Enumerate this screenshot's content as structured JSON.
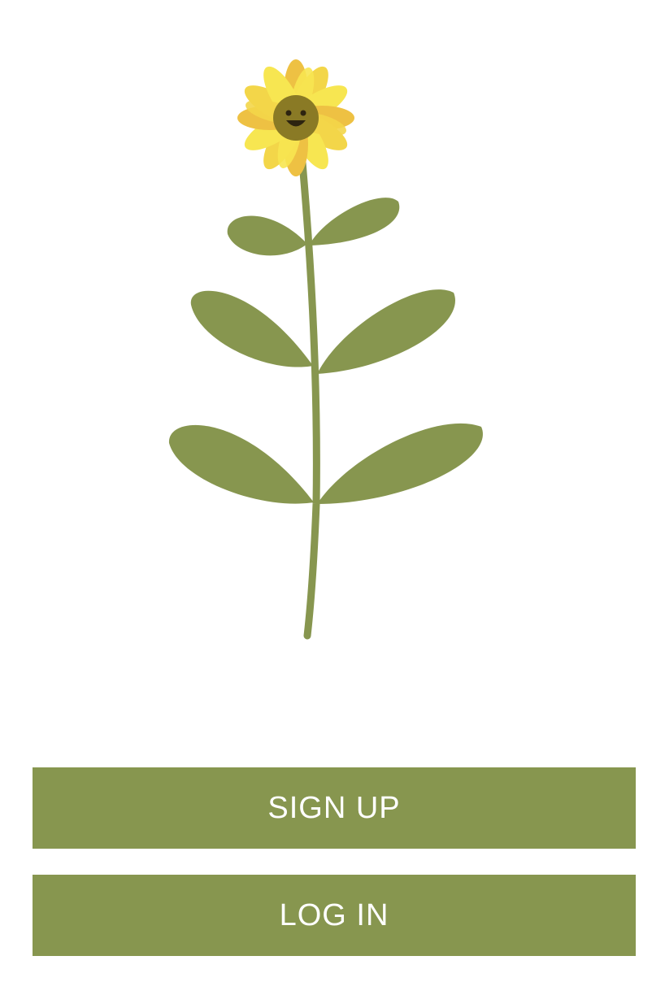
{
  "illustration": {
    "subject": "sunflower-plant",
    "colors": {
      "stem": "#87964f",
      "leaf": "#87964f",
      "petal_light": "#f7e651",
      "petal_mid": "#f3d649",
      "petal_dark": "#eec143",
      "face": "#8a7a25",
      "face_features": "#2d2410"
    }
  },
  "actions": {
    "sign_up_label": "SIGN UP",
    "log_in_label": "LOG IN"
  },
  "theme": {
    "button_color": "#87964f",
    "button_text_color": "#ffffff",
    "background": "#ffffff"
  }
}
